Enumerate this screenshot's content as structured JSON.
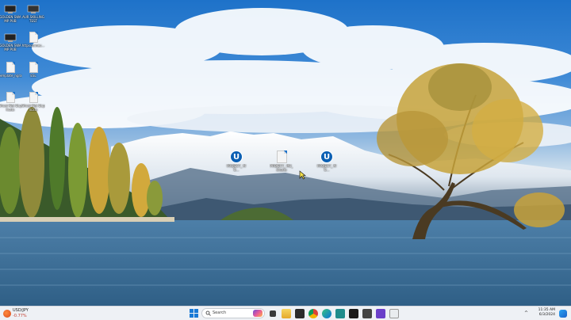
{
  "desktop": {
    "icons_left": [
      {
        "label": "GOLDEN SWAMP PUB"
      },
      {
        "label": "AUR SKILLING TEST"
      },
      {
        "label": "GOLDEN SWAMP PUB"
      },
      {
        "label": "httpsconnec..."
      },
      {
        "label": "template_ngra"
      },
      {
        "label": "ESL"
      },
      {
        "label": "Ghost Net Duplicats"
      },
      {
        "label": "Ghost Net Duplicats"
      }
    ],
    "icons_center": [
      {
        "label": "PROJECT_ MU..."
      },
      {
        "label": "PROJECT_ MU_xhosts"
      },
      {
        "label": "PROJECT_ MU..."
      }
    ]
  },
  "taskbar": {
    "weather_title": "USD/JPY",
    "weather_change": "-0.77%",
    "search_placeholder": "Search",
    "time": "11:35 AM",
    "date": "6/3/2024"
  },
  "colors": {
    "taskbar_bg": "#eef1f5",
    "accent": "#1a7ad6",
    "weather_negative": "#c23b2b"
  }
}
